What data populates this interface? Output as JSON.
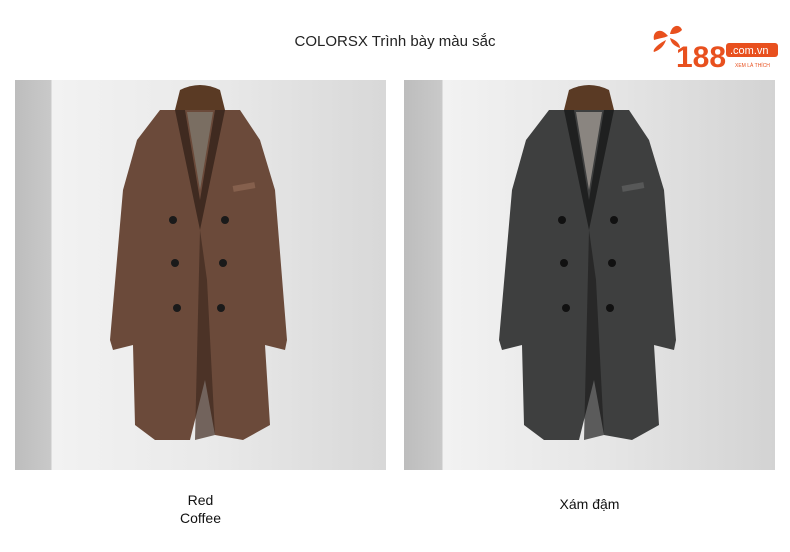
{
  "header": {
    "title": "COLORSX Trình bày màu sắc"
  },
  "logo": {
    "number": "188",
    "domain": ".com.vn",
    "tagline": "XEM LÀ THÍCH"
  },
  "products": [
    {
      "caption_lines": [
        "Red",
        "Coffee"
      ],
      "coat_color": "#6b4a3a",
      "coat_shadow": "#3f2a20",
      "coat_highlight": "#85604d"
    },
    {
      "caption_lines": [
        "Xám đậm"
      ],
      "coat_color": "#3e3f3f",
      "coat_shadow": "#1f2020",
      "coat_highlight": "#575858"
    }
  ],
  "colors": {
    "accent": "#e8501e",
    "text": "#222222"
  }
}
